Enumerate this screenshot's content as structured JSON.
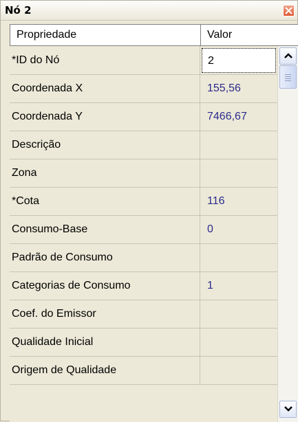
{
  "window": {
    "title": "Nó 2"
  },
  "grid": {
    "header": {
      "property": "Propriedade",
      "value": "Valor"
    },
    "rows": [
      {
        "property": "*ID do Nó",
        "value": "2"
      },
      {
        "property": "Coordenada X",
        "value": "155,56"
      },
      {
        "property": "Coordenada Y",
        "value": "7466,67"
      },
      {
        "property": "Descrição",
        "value": ""
      },
      {
        "property": "Zona",
        "value": ""
      },
      {
        "property": "*Cota",
        "value": "116"
      },
      {
        "property": "Consumo-Base",
        "value": "0"
      },
      {
        "property": "Padrão de Consumo",
        "value": ""
      },
      {
        "property": "Categorias de Consumo",
        "value": "1"
      },
      {
        "property": "Coef. do Emissor",
        "value": ""
      },
      {
        "property": "Qualidade Inicial",
        "value": ""
      },
      {
        "property": "Origem de Qualidade",
        "value": ""
      }
    ]
  },
  "icons": {
    "close": "close-icon",
    "scroll_up": "chevron-up-icon",
    "scroll_down": "chevron-down-icon",
    "thumb_grip": "grip-icon"
  },
  "colors": {
    "value_text": "#2b2b8c",
    "close_button": "#e05a35",
    "window_bg": "#ece9d8"
  }
}
